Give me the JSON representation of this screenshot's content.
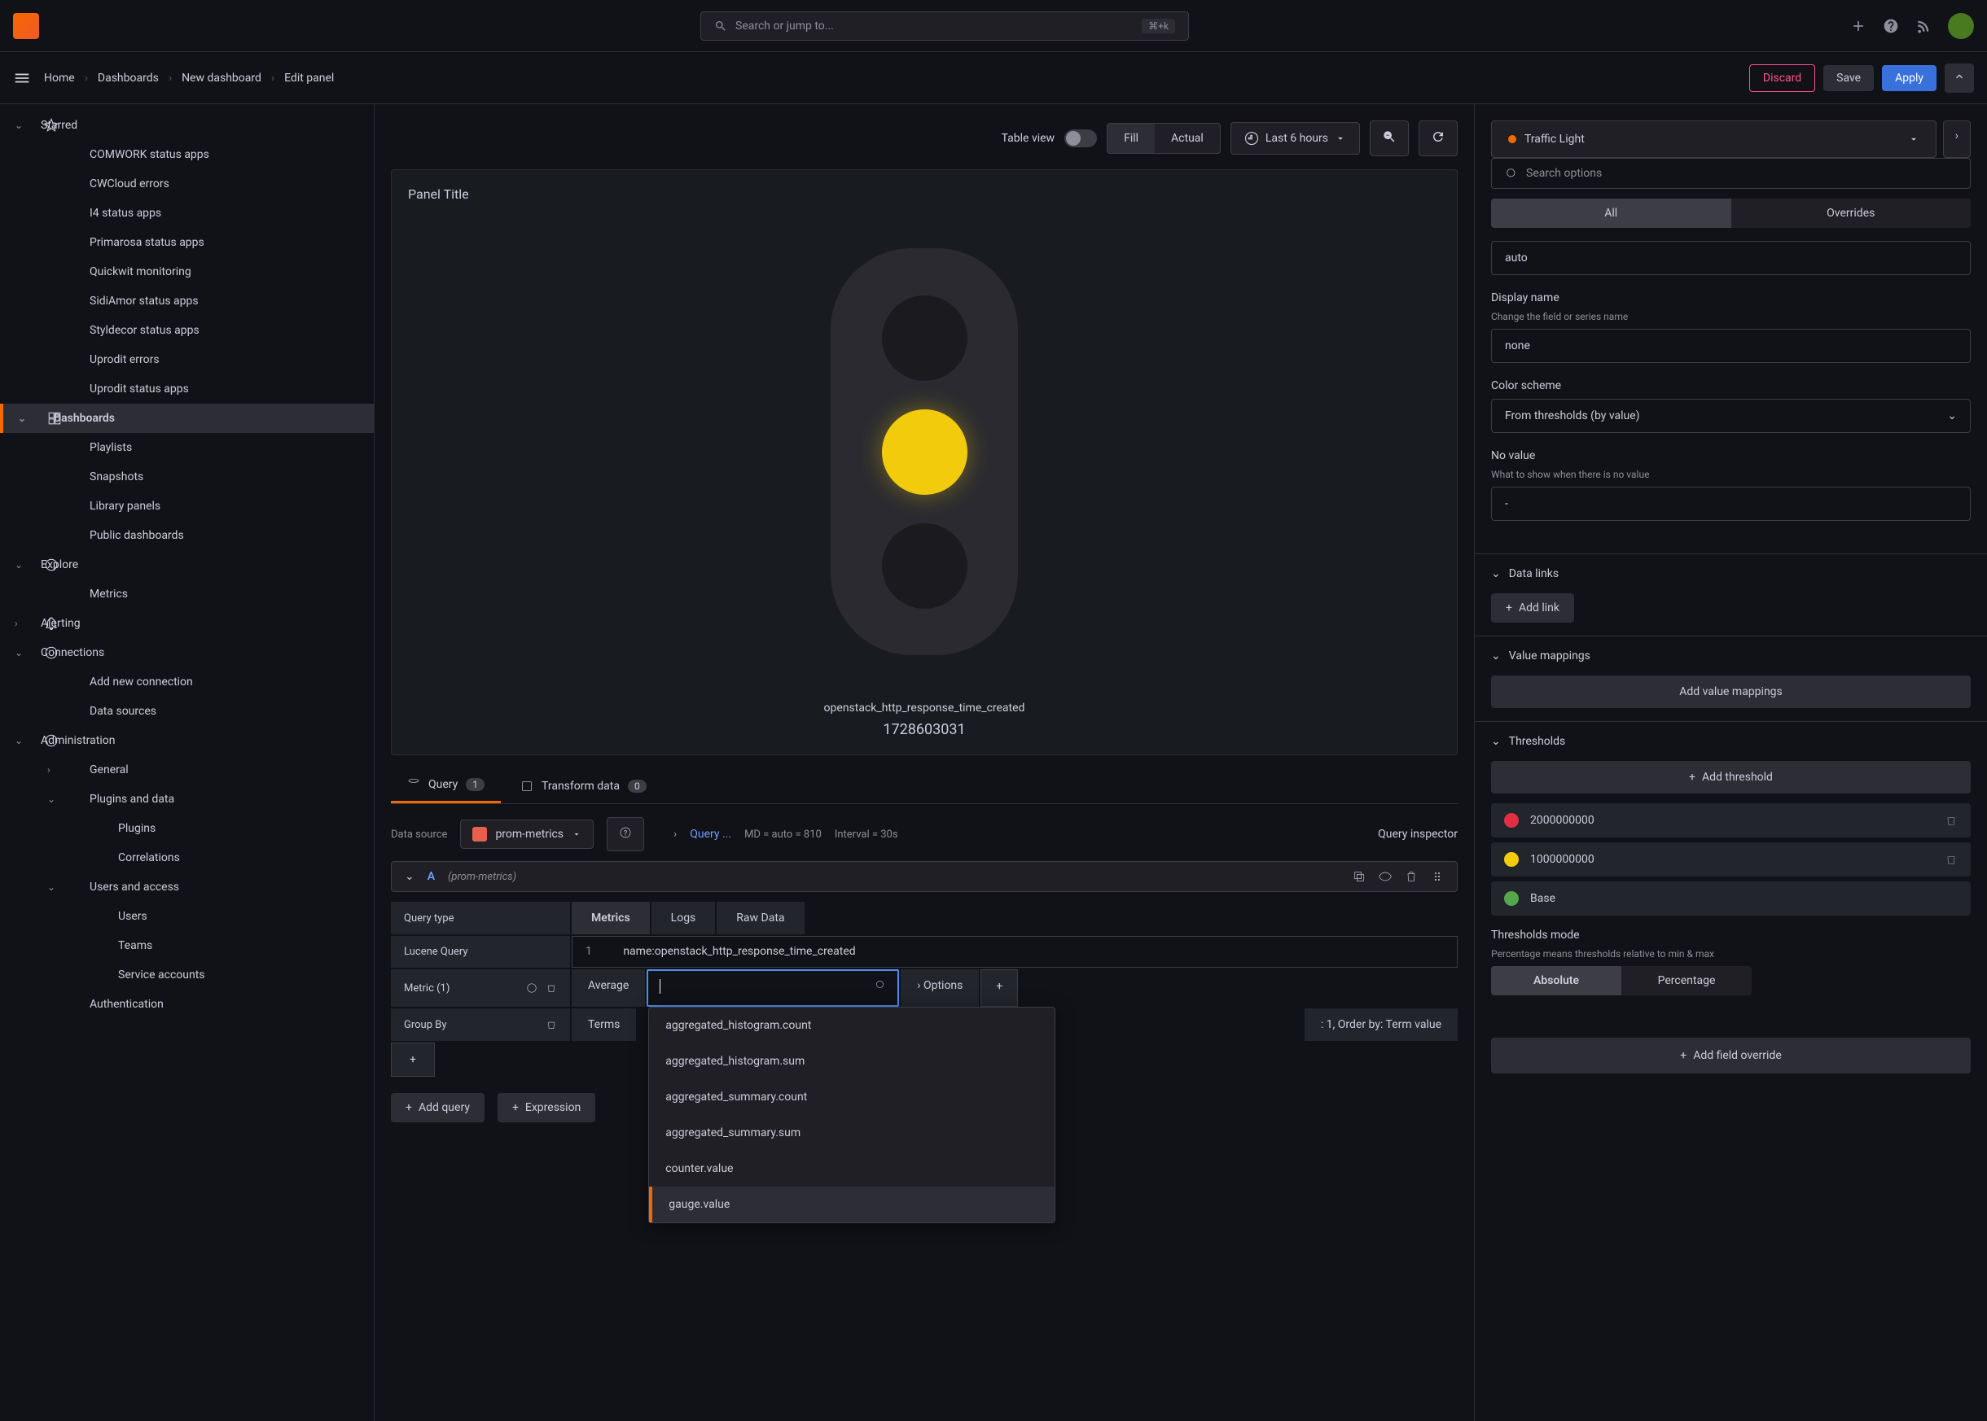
{
  "topbar": {
    "search_placeholder": "Search or jump to...",
    "shortcut": "⌘+k"
  },
  "breadcrumb": {
    "home": "Home",
    "dashboards": "Dashboards",
    "new_dashboard": "New dashboard",
    "edit_panel": "Edit panel"
  },
  "actions": {
    "discard": "Discard",
    "save": "Save",
    "apply": "Apply"
  },
  "sidebar": {
    "starred": "Starred",
    "items": [
      "COMWORK status apps",
      "CWCloud errors",
      "I4 status apps",
      "Primarosa status apps",
      "Quickwit monitoring",
      "SidiAmor status apps",
      "Styldecor status apps",
      "Uprodit errors",
      "Uprodit status apps"
    ],
    "dashboards": "Dashboards",
    "playlists": "Playlists",
    "snapshots": "Snapshots",
    "library_panels": "Library panels",
    "public_dashboards": "Public dashboards",
    "explore": "Explore",
    "metrics": "Metrics",
    "alerting": "Alerting",
    "connections": "Connections",
    "add_connection": "Add new connection",
    "data_sources": "Data sources",
    "administration": "Administration",
    "general": "General",
    "plugins_data": "Plugins and data",
    "plugins": "Plugins",
    "correlations": "Correlations",
    "users_access": "Users and access",
    "users": "Users",
    "teams": "Teams",
    "service_accounts": "Service accounts",
    "authentication": "Authentication"
  },
  "toolbar": {
    "table_view": "Table view",
    "fill": "Fill",
    "actual": "Actual",
    "time_range": "Last 6 hours"
  },
  "panel": {
    "title": "Panel Title",
    "metric_name": "openstack_http_response_time_created",
    "metric_value": "1728603031"
  },
  "tabs": {
    "query": "Query",
    "query_count": "1",
    "transform": "Transform data",
    "transform_count": "0"
  },
  "query": {
    "data_source_label": "Data source",
    "data_source": "prom-metrics",
    "options": "Query ...",
    "md": "MD = auto = 810",
    "interval": "Interval = 30s",
    "inspector": "Query inspector",
    "letter": "A",
    "ds_name": "(prom-metrics)",
    "query_type": "Query type",
    "type_metrics": "Metrics",
    "type_logs": "Logs",
    "type_raw": "Raw Data",
    "lucene": "Lucene Query",
    "lucene_line": "1",
    "lucene_val": "name:openstack_http_response_time_created",
    "metric": "Metric (1)",
    "metric_fn": "Average",
    "options_label": "Options",
    "group_by": "Group By",
    "group_fn": "Terms",
    "group_meta": ": 1, Order by: Term value",
    "add_query": "Add query",
    "expression": "Expression"
  },
  "dropdown": {
    "items": [
      "aggregated_histogram.count",
      "aggregated_histogram.sum",
      "aggregated_summary.count",
      "aggregated_summary.sum",
      "counter.value",
      "gauge.value"
    ]
  },
  "rightpanel": {
    "viz_type": "Traffic Light",
    "search_placeholder": "Search options",
    "tab_all": "All",
    "tab_overrides": "Overrides",
    "auto": "auto",
    "display_name": "Display name",
    "display_name_sub": "Change the field or series name",
    "display_name_val": "none",
    "color_scheme": "Color scheme",
    "color_scheme_val": "From thresholds (by value)",
    "no_value": "No value",
    "no_value_sub": "What to show when there is no value",
    "no_value_val": "-",
    "data_links": "Data links",
    "add_link": "Add link",
    "value_mappings": "Value mappings",
    "add_value_mappings": "Add value mappings",
    "thresholds": "Thresholds",
    "add_threshold": "Add threshold",
    "threshold_red": "2000000000",
    "threshold_yellow": "1000000000",
    "threshold_base": "Base",
    "thresholds_mode": "Thresholds mode",
    "thresholds_mode_sub": "Percentage means thresholds relative to min & max",
    "absolute": "Absolute",
    "percentage": "Percentage",
    "add_override": "Add field override"
  }
}
